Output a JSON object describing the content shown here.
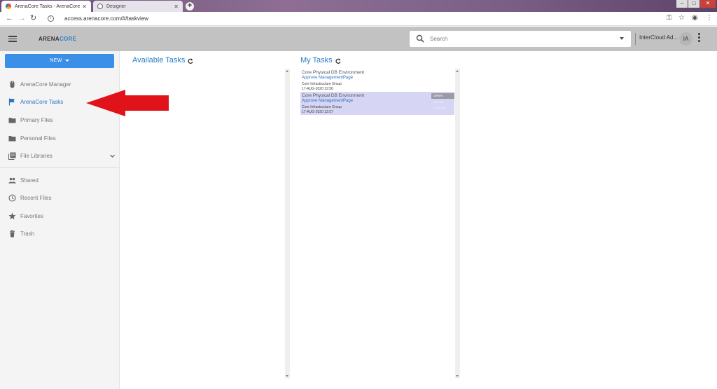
{
  "browser": {
    "tabs": [
      {
        "title": "ArenaCore Tasks - ArenaCore",
        "active": true
      },
      {
        "title": "Designer",
        "active": false
      }
    ],
    "url": "access.arenacore.com/#/taskview"
  },
  "header": {
    "logo_prefix": "ARENA",
    "logo_suffix": "CORE",
    "search_placeholder": "Search",
    "tenant": "InterCloud Ad...",
    "avatar_initials": "IA"
  },
  "sidebar": {
    "new_label": "NEW",
    "items": [
      {
        "label": "ArenaCore Manager",
        "icon": "mouse-icon",
        "active": false
      },
      {
        "label": "ArenaCore Tasks",
        "icon": "flag-icon",
        "active": true
      },
      {
        "label": "Primary Files",
        "icon": "folder-icon",
        "active": false
      },
      {
        "label": "Personal Files",
        "icon": "folder-icon",
        "active": false
      },
      {
        "label": "File Libraries",
        "icon": "library-icon",
        "active": false,
        "expandable": true
      }
    ],
    "secondary": [
      {
        "label": "Shared",
        "icon": "people-icon"
      },
      {
        "label": "Recent Files",
        "icon": "clock-icon"
      },
      {
        "label": "Favorites",
        "icon": "star-icon"
      },
      {
        "label": "Trash",
        "icon": "trash-icon"
      }
    ]
  },
  "main": {
    "available": {
      "title": "Available Tasks"
    },
    "my_tasks": {
      "title": "My Tasks",
      "tasks": [
        {
          "title": "Core Physical DB Environment",
          "link": "Approve ManagementPage",
          "group": "Core Infrastructure Group",
          "date": "17-AUG-2020 12:56",
          "selected": false
        },
        {
          "title": "Core Physical DB Environment",
          "link": "Approve ManagementPage",
          "group": "Core Infrastructure Group",
          "date": "17-AUG-2020 12:57",
          "selected": true,
          "actions": [
            "OPEN",
            "CLAIM",
            "CANCEL"
          ]
        }
      ]
    }
  },
  "colors": {
    "accent": "#2a7fc8",
    "new_button": "#3b8fe6",
    "selected_row": "#d6d6f4",
    "annotation_arrow": "#e0131a"
  }
}
